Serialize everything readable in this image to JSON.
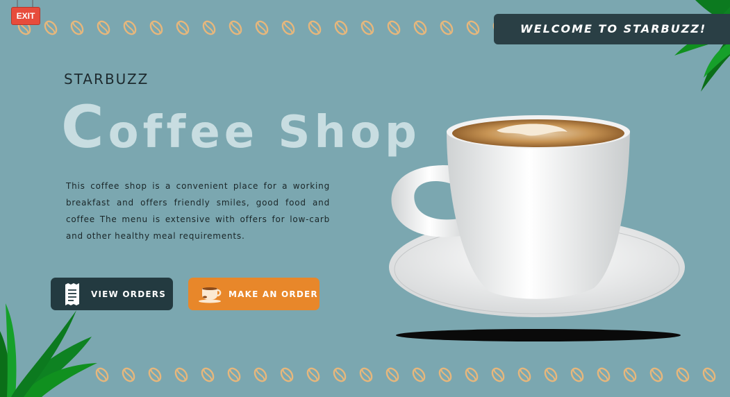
{
  "exit_sign": {
    "label": "EXIT",
    "icon": "exit-sign-icon"
  },
  "welcome_banner": {
    "text": "WELCOME TO STARBUZZ!"
  },
  "brand": {
    "name": "STARBUZZ"
  },
  "headline": {
    "first_letter": "C",
    "rest": "offee Shop"
  },
  "description": "This coffee shop is a convenient place for a working breakfast and offers friendly smiles, good food and coffee The menu is extensive with offers for low-carb and other healthy meal requirements.",
  "buttons": {
    "view_orders": {
      "label": "VIEW ORDERS",
      "icon": "receipt-icon"
    },
    "make_order": {
      "label": "MAKE AN ORDER",
      "icon": "coffee-cup-icon"
    }
  },
  "decor": {
    "bean_icon": "coffee-bean-icon",
    "leaf_icon": "leaf-icon",
    "hero_image": "coffee-cup-image"
  },
  "colors": {
    "background": "#7ba7b0",
    "dark_accent": "#233a40",
    "orange_accent": "#e8872a",
    "exit_red": "#e74c3c",
    "bean": "#e6b77c"
  }
}
